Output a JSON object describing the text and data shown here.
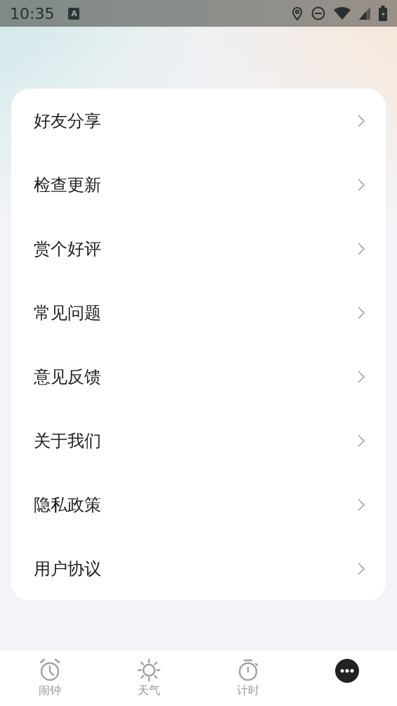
{
  "status_bar": {
    "time": "10:35",
    "keyboard_badge": "A"
  },
  "menu": [
    {
      "label": "好友分享"
    },
    {
      "label": "检查更新"
    },
    {
      "label": "赏个好评"
    },
    {
      "label": "常见问题"
    },
    {
      "label": "意见反馈"
    },
    {
      "label": "关于我们"
    },
    {
      "label": "隐私政策"
    },
    {
      "label": "用户协议"
    }
  ],
  "tabs": [
    {
      "kind": "alarm",
      "label": "闹钟",
      "selected": false
    },
    {
      "kind": "weather",
      "label": "天气",
      "selected": false
    },
    {
      "kind": "timer",
      "label": "计时",
      "selected": false
    },
    {
      "kind": "more",
      "selected": true
    }
  ]
}
